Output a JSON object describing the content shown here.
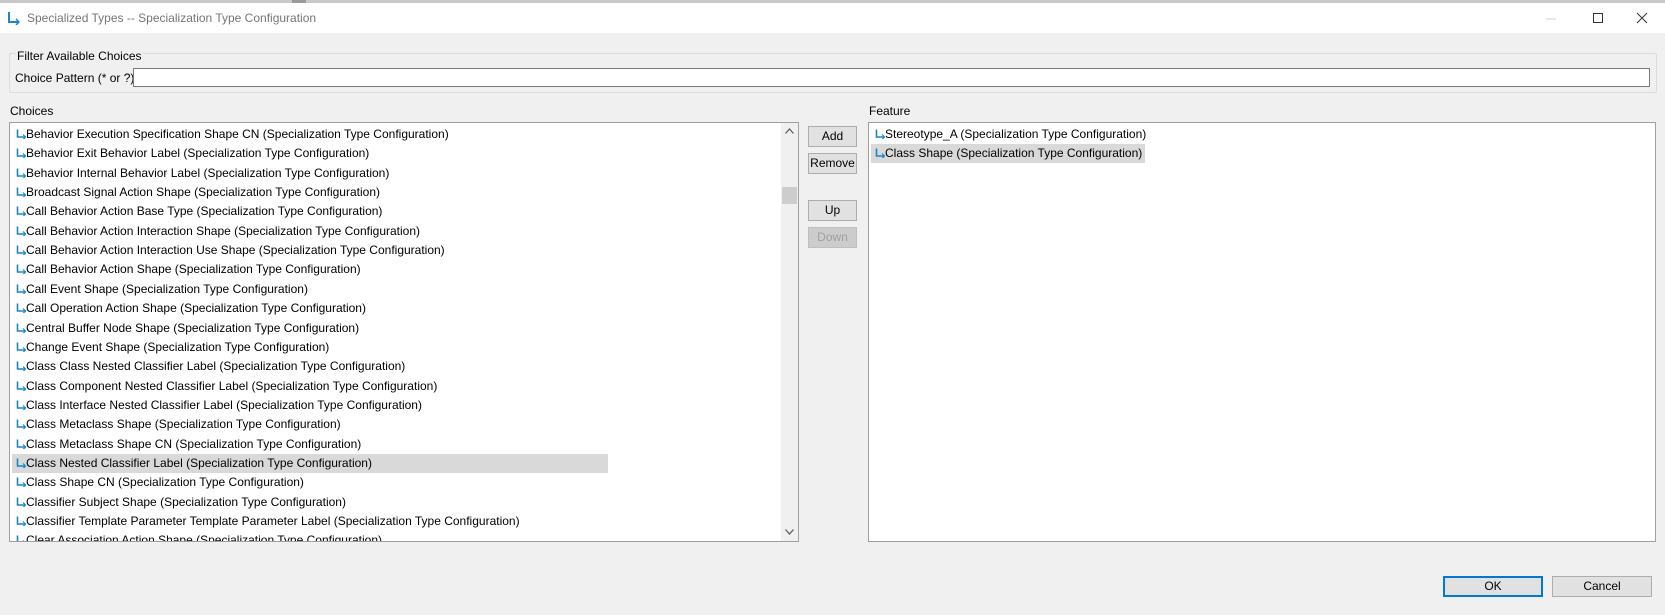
{
  "window": {
    "title": "Specialized Types -- Specialization Type Configuration"
  },
  "filter": {
    "group_label": "Filter Available Choices",
    "pattern_label": "Choice Pattern (* or ?)",
    "pattern_value": ""
  },
  "choices": {
    "label": "Choices",
    "items": [
      "Behavior Execution Specification Shape CN (Specialization Type Configuration)",
      "Behavior Exit Behavior Label (Specialization Type Configuration)",
      "Behavior Internal Behavior Label (Specialization Type Configuration)",
      "Broadcast Signal Action Shape (Specialization Type Configuration)",
      "Call Behavior Action Base Type (Specialization Type Configuration)",
      "Call Behavior Action Interaction Shape (Specialization Type Configuration)",
      "Call Behavior Action Interaction Use Shape (Specialization Type Configuration)",
      "Call Behavior Action Shape (Specialization Type Configuration)",
      "Call Event Shape (Specialization Type Configuration)",
      "Call Operation Action Shape (Specialization Type Configuration)",
      "Central Buffer Node Shape (Specialization Type Configuration)",
      "Change Event Shape (Specialization Type Configuration)",
      "Class Class Nested Classifier Label (Specialization Type Configuration)",
      "Class Component Nested Classifier Label (Specialization Type Configuration)",
      "Class Interface Nested Classifier Label (Specialization Type Configuration)",
      "Class Metaclass Shape (Specialization Type Configuration)",
      "Class Metaclass Shape CN (Specialization Type Configuration)",
      "Class Nested Classifier Label (Specialization Type Configuration)",
      "Class Shape CN (Specialization Type Configuration)",
      "Classifier Subject Shape (Specialization Type Configuration)",
      "Classifier Template Parameter Template Parameter Label (Specialization Type Configuration)",
      "Clear Association Action Shape (Specialization Type Configuration)"
    ],
    "selected": "Class Nested Classifier Label (Specialization Type Configuration)"
  },
  "feature": {
    "label": "Feature",
    "items": [
      "Stereotype_A (Specialization Type Configuration)",
      "Class Shape (Specialization Type Configuration)"
    ],
    "selected": "Class Shape (Specialization Type Configuration)"
  },
  "buttons": {
    "add": "Add",
    "remove": "Remove",
    "up": "Up",
    "down": "Down",
    "ok": "OK",
    "cancel": "Cancel"
  },
  "colors": {
    "item_icon": "#1a86c8",
    "selection": "#d9d9d9",
    "default_button_border": "#0078d7",
    "dialog_background": "#f0f0f0"
  },
  "icons": {
    "window": "specialization-arrow-icon",
    "item": "specialization-arrow-icon",
    "minimize": "minimize-icon",
    "maximize": "maximize-icon",
    "close": "close-icon"
  }
}
